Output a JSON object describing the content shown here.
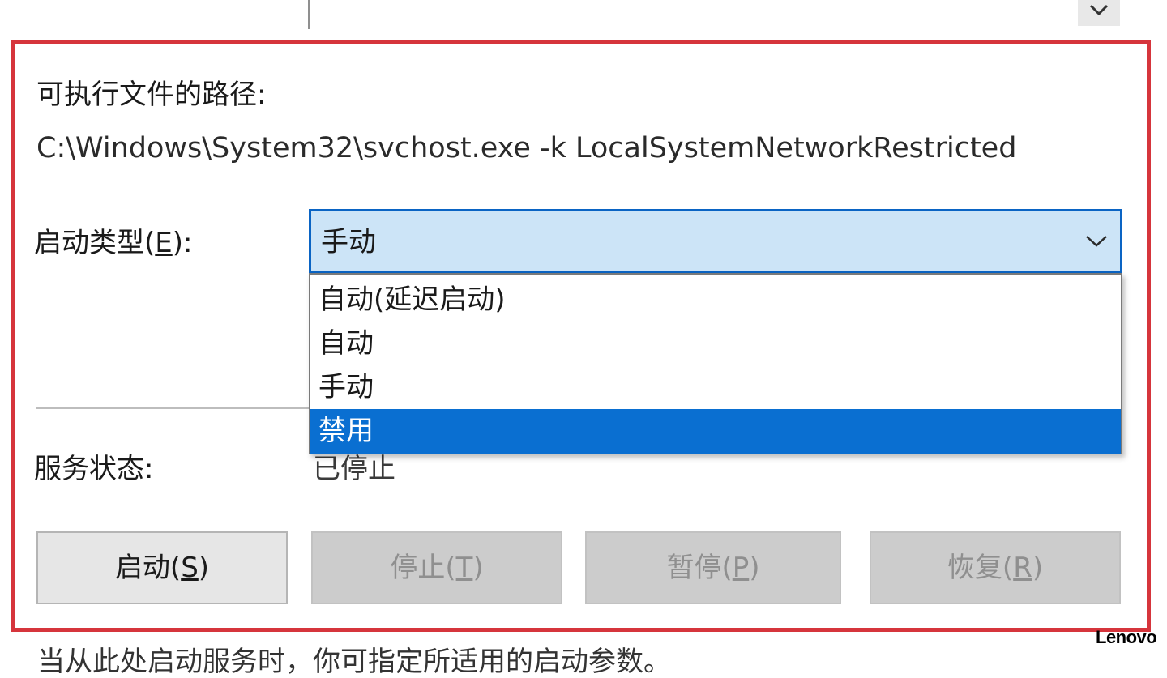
{
  "properties": {
    "path_label": "可执行文件的路径:",
    "path_value": "C:\\Windows\\System32\\svchost.exe -k LocalSystemNetworkRestricted",
    "startup_type": {
      "label_text": "启动类型(",
      "label_hotkey": "E",
      "label_suffix": "):",
      "selected": "手动",
      "options": [
        "自动(延迟启动)",
        "自动",
        "手动",
        "禁用"
      ],
      "highlighted": "禁用"
    },
    "service_status": {
      "label": "服务状态:",
      "value": "已停止"
    },
    "buttons": {
      "start": {
        "text": "启动(",
        "hotkey": "S",
        "suffix": ")"
      },
      "stop": {
        "text": "停止(",
        "hotkey": "T",
        "suffix": ")"
      },
      "pause": {
        "text": "暂停(",
        "hotkey": "P",
        "suffix": ")"
      },
      "resume": {
        "text": "恢复(",
        "hotkey": "R",
        "suffix": ")"
      }
    },
    "footer_text": "当从此处启动服务时，你可指定所适用的启动参数。"
  },
  "watermark": "Lenovo",
  "colors": {
    "highlight_frame": "#d6353c",
    "combo_bg": "#cce4f7",
    "combo_border": "#0a64c4",
    "selected_option_bg": "#0a6fd1"
  },
  "icons": {
    "combo_arrow": "chevron-down-icon",
    "top_arrow": "chevron-down-icon"
  }
}
